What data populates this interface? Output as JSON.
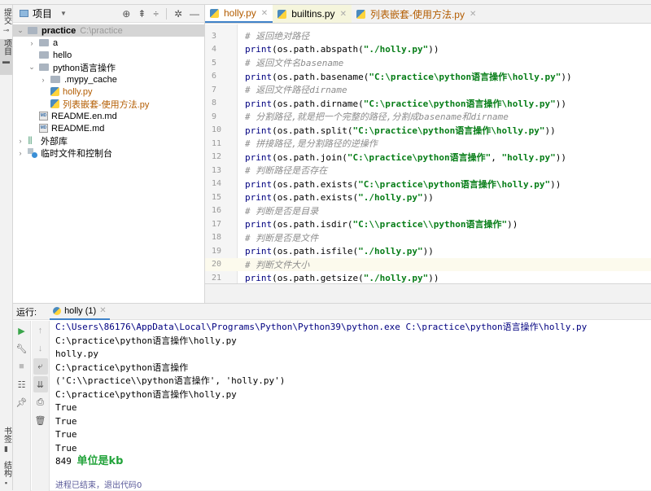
{
  "left_strip": {
    "commit_tab": "提交",
    "project_tab": "项目",
    "bookmarks_tab": "书签",
    "structure_tab": "结构"
  },
  "project_panel": {
    "title": "项目",
    "tree": [
      {
        "label": "practice",
        "suffix": "C:\\practice",
        "type": "folder",
        "expanded": true,
        "selected": true
      },
      {
        "label": "a",
        "type": "folder",
        "expanded": false
      },
      {
        "label": "hello",
        "type": "folder"
      },
      {
        "label": "python语言操作",
        "type": "folder",
        "expanded": true
      },
      {
        "label": ".mypy_cache",
        "type": "folder",
        "expanded": false
      },
      {
        "label": "holly.py",
        "type": "python"
      },
      {
        "label": "列表嵌套-使用方法.py",
        "type": "python"
      },
      {
        "label": "README.en.md",
        "type": "markdown"
      },
      {
        "label": "README.md",
        "type": "markdown"
      },
      {
        "label": "外部库",
        "type": "library",
        "expanded": false
      },
      {
        "label": "临时文件和控制台",
        "type": "scratch",
        "expanded": false
      }
    ]
  },
  "editor": {
    "tabs": [
      {
        "label": "holly.py",
        "active": true
      },
      {
        "label": "builtins.py",
        "active": false
      },
      {
        "label": "列表嵌套-使用方法.py",
        "active": false
      }
    ],
    "current_line": 20,
    "lines": [
      {
        "num": "3",
        "type": "comment",
        "text": "# 返回绝对路径"
      },
      {
        "num": "4",
        "type": "code",
        "pre": "print(os.path.abspath(",
        "str": "\"./holly.py\"",
        "post": "))"
      },
      {
        "num": "5",
        "type": "comment",
        "text": "# 返回文件名basename"
      },
      {
        "num": "6",
        "type": "code",
        "pre": "print(os.path.basename(",
        "str": "\"C:\\practice\\python语言操作\\holly.py\"",
        "post": "))"
      },
      {
        "num": "7",
        "type": "comment",
        "text": "# 返回文件路径dirname"
      },
      {
        "num": "8",
        "type": "code",
        "pre": "print(os.path.dirname(",
        "str": "\"C:\\practice\\python语言操作\\holly.py\"",
        "post": "))"
      },
      {
        "num": "9",
        "type": "comment",
        "text": "# 分割路径,就是把一个完整的路径,分割成basename和dirname"
      },
      {
        "num": "10",
        "type": "code",
        "pre": "print(os.path.split(",
        "str": "\"C:\\practice\\python语言操作\\holly.py\"",
        "post": "))"
      },
      {
        "num": "11",
        "type": "comment",
        "text": "# 拼接路径,是分割路径的逆操作"
      },
      {
        "num": "12",
        "type": "code",
        "pre": "print(os.path.join(",
        "str": "\"C:\\practice\\python语言操作\"",
        "mid": ", ",
        "str2": "\"holly.py\"",
        "post": "))"
      },
      {
        "num": "13",
        "type": "comment",
        "text": "# 判断路径是否存在"
      },
      {
        "num": "14",
        "type": "code",
        "pre": "print(os.path.exists(",
        "str": "\"C:\\practice\\python语言操作\\holly.py\"",
        "post": "))"
      },
      {
        "num": "15",
        "type": "code",
        "pre": "print(os.path.exists(",
        "str": "\"./holly.py\"",
        "post": "))"
      },
      {
        "num": "16",
        "type": "comment",
        "text": "# 判断是否是目录"
      },
      {
        "num": "17",
        "type": "code",
        "pre": "print(os.path.isdir(",
        "str": "\"C:\\\\practice\\\\python语言操作\"",
        "post": "))"
      },
      {
        "num": "18",
        "type": "comment",
        "text": "# 判断是否是文件"
      },
      {
        "num": "19",
        "type": "code",
        "pre": "print(os.path.isfile(",
        "str": "\"./holly.py\"",
        "post": "))"
      },
      {
        "num": "20",
        "type": "comment",
        "text": "# 判断文件大小"
      },
      {
        "num": "21",
        "type": "code",
        "pre": "print(os.path.getsize(",
        "str": "\"./holly.py\"",
        "post": "))"
      }
    ]
  },
  "run_panel": {
    "label": "运行:",
    "tab_label": "holly (1)",
    "output": [
      {
        "text": "C:\\Users\\86176\\AppData\\Local\\Programs\\Python\\Python39\\python.exe C:\\practice\\python语言操作\\holly.py",
        "kind": "cmd"
      },
      {
        "text": "C:\\practice\\python语言操作\\holly.py",
        "kind": "out"
      },
      {
        "text": "holly.py",
        "kind": "out"
      },
      {
        "text": "C:\\practice\\python语言操作",
        "kind": "out"
      },
      {
        "text": "('C:\\\\practice\\\\python语言操作', 'holly.py')",
        "kind": "out"
      },
      {
        "text": "C:\\practice\\python语言操作\\holly.py",
        "kind": "out"
      },
      {
        "text": "True",
        "kind": "out"
      },
      {
        "text": "True",
        "kind": "out"
      },
      {
        "text": "True",
        "kind": "out"
      },
      {
        "text": "True",
        "kind": "out"
      }
    ],
    "size_value": "849",
    "size_note": "单位是kb",
    "exit_text": "进程已结束，退出代码0"
  },
  "colors": {
    "accent": "#4083c9",
    "string": "#067d17",
    "comment": "#8c8c8c",
    "keyword": "#000080",
    "annotation_green": "#22a33a",
    "current_line": "#fcfaed"
  }
}
